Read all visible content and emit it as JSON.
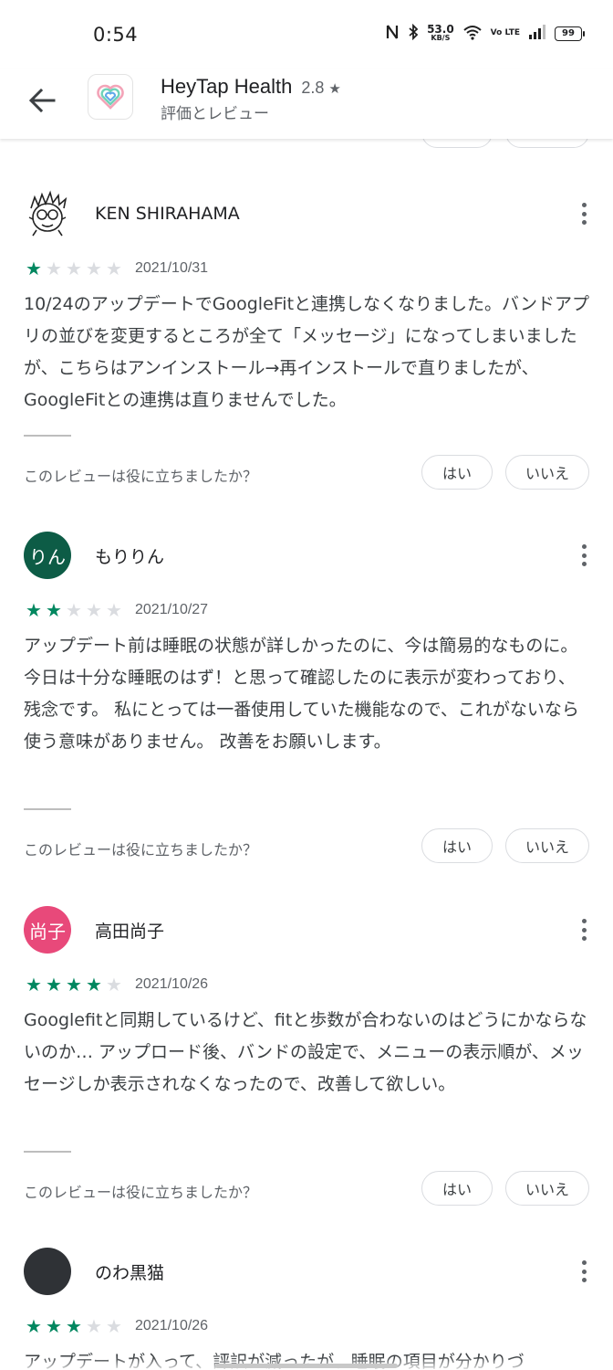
{
  "status_bar": {
    "time": "0:54",
    "net_speed_value": "53.0",
    "net_speed_unit": "KB/S",
    "volte": "Vo LTE",
    "battery": "99"
  },
  "header": {
    "app_name": "HeyTap Health",
    "rating": "2.8",
    "rating_star": "★",
    "subtitle": "評価とレビュー"
  },
  "colors": {
    "star_on": "#01875f",
    "star_off": "#dadce0",
    "avatar_moririn": "#0d5c46",
    "avatar_takada": "#e8497a",
    "avatar_nowa": "#2f3236"
  },
  "helpful": {
    "question": "このレビューは役に立ちましたか？",
    "yes": "はい",
    "no": "いいえ"
  },
  "reviews": [
    {
      "name": "KEN SHIRAHAMA",
      "avatar_text": "",
      "rating": 1,
      "date": "2021/10/31",
      "text": "10/24のアップデートでGoogleFitと連携しなくなりました。バンドアプリの並びを変更するところが全て「メッセージ」になってしまいましたが、こちらはアンインストール→再インストールで直りましたが、GoogleFitとの連携は直りませんでした。"
    },
    {
      "name": "もりりん",
      "avatar_text": "りん",
      "rating": 2,
      "date": "2021/10/27",
      "text": "アップデート前は睡眠の状態が詳しかったのに、今は簡易的なものに。 今日は十分な睡眠のはず！と思って確認したのに表示が変わっており、残念です。 私にとっては一番使用していた機能なので、これがないなら使う意味がありません。 改善をお願いします。"
    },
    {
      "name": "高田尚子",
      "avatar_text": "尚子",
      "rating": 4,
      "date": "2021/10/26",
      "text": "Googlefitと同期しているけど、fitと歩数が合わないのはどうにかならないのか… アップロード後、バンドの設定で、メニューの表示順が、メッセージしか表示されなくなったので、改善して欲しい。"
    },
    {
      "name": "のわ黒猫",
      "avatar_text": "",
      "rating": 3,
      "date": "2021/10/26",
      "text": "アップデートが入って、評訳が減ったが、睡眠の項目が分かりづ"
    }
  ]
}
